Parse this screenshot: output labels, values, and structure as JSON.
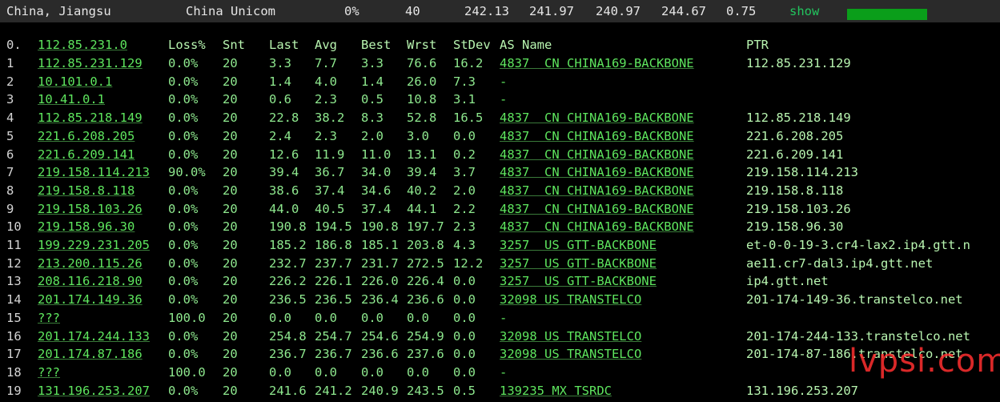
{
  "summary": {
    "location": "China, Jiangsu",
    "isp": "China Unicom",
    "loss": "0%",
    "sent": "40",
    "last": "242.13",
    "avg": "241.97",
    "best": "240.97",
    "worst": "244.67",
    "stdev": "0.75",
    "show_label": "show",
    "bar_color": "#0a9e1a"
  },
  "header": {
    "idx": "0.",
    "host": "112.85.231.0",
    "loss": "Loss%",
    "snt": "Snt",
    "last": "Last",
    "avg": "Avg",
    "best": "Best",
    "wrst": "Wrst",
    "stdev": "StDev",
    "as_name": "AS Name",
    "ptr": "PTR"
  },
  "rows": [
    {
      "idx": "1",
      "host": "112.85.231.129",
      "loss": "0.0%",
      "snt": "20",
      "last": "3.3",
      "avg": "7.7",
      "best": "3.3",
      "wrst": "76.6",
      "stdev": "16.2",
      "as": "4837  CN CHINA169-BACKBONE",
      "ptr": "112.85.231.129"
    },
    {
      "idx": "2",
      "host": "10.101.0.1",
      "loss": "0.0%",
      "snt": "20",
      "last": "1.4",
      "avg": "4.0",
      "best": "1.4",
      "wrst": "26.0",
      "stdev": "7.3",
      "as": "-",
      "ptr": ""
    },
    {
      "idx": "3",
      "host": "10.41.0.1",
      "loss": "0.0%",
      "snt": "20",
      "last": "0.6",
      "avg": "2.3",
      "best": "0.5",
      "wrst": "10.8",
      "stdev": "3.1",
      "as": "-",
      "ptr": ""
    },
    {
      "idx": "4",
      "host": "112.85.218.149",
      "loss": "0.0%",
      "snt": "20",
      "last": "22.8",
      "avg": "38.2",
      "best": "8.3",
      "wrst": "52.8",
      "stdev": "16.5",
      "as": "4837  CN CHINA169-BACKBONE",
      "ptr": "112.85.218.149"
    },
    {
      "idx": "5",
      "host": "221.6.208.205",
      "loss": "0.0%",
      "snt": "20",
      "last": "2.4",
      "avg": "2.3",
      "best": "2.0",
      "wrst": "3.0",
      "stdev": "0.0",
      "as": "4837  CN CHINA169-BACKBONE",
      "ptr": "221.6.208.205"
    },
    {
      "idx": "6",
      "host": "221.6.209.141",
      "loss": "0.0%",
      "snt": "20",
      "last": "12.6",
      "avg": "11.9",
      "best": "11.0",
      "wrst": "13.1",
      "stdev": "0.2",
      "as": "4837  CN CHINA169-BACKBONE",
      "ptr": "221.6.209.141"
    },
    {
      "idx": "7",
      "host": "219.158.114.213",
      "loss": "90.0%",
      "snt": "20",
      "last": "39.4",
      "avg": "36.7",
      "best": "34.0",
      "wrst": "39.4",
      "stdev": "3.7",
      "as": "4837  CN CHINA169-BACKBONE",
      "ptr": "219.158.114.213"
    },
    {
      "idx": "8",
      "host": "219.158.8.118",
      "loss": "0.0%",
      "snt": "20",
      "last": "38.6",
      "avg": "37.4",
      "best": "34.6",
      "wrst": "40.2",
      "stdev": "2.0",
      "as": "4837  CN CHINA169-BACKBONE",
      "ptr": "219.158.8.118"
    },
    {
      "idx": "9",
      "host": "219.158.103.26",
      "loss": "0.0%",
      "snt": "20",
      "last": "44.0",
      "avg": "40.5",
      "best": "37.4",
      "wrst": "44.1",
      "stdev": "2.2",
      "as": "4837  CN CHINA169-BACKBONE",
      "ptr": "219.158.103.26"
    },
    {
      "idx": "10",
      "host": "219.158.96.30",
      "loss": "0.0%",
      "snt": "20",
      "last": "190.8",
      "avg": "194.5",
      "best": "190.8",
      "wrst": "197.7",
      "stdev": "2.3",
      "as": "4837  CN CHINA169-BACKBONE",
      "ptr": "219.158.96.30"
    },
    {
      "idx": "11",
      "host": "199.229.231.205",
      "loss": "0.0%",
      "snt": "20",
      "last": "185.2",
      "avg": "186.8",
      "best": "185.1",
      "wrst": "203.8",
      "stdev": "4.3",
      "as": "3257  US GTT-BACKBONE",
      "ptr": "et-0-0-19-3.cr4-lax2.ip4.gtt.n"
    },
    {
      "idx": "12",
      "host": "213.200.115.26",
      "loss": "0.0%",
      "snt": "20",
      "last": "232.7",
      "avg": "237.7",
      "best": "231.7",
      "wrst": "272.5",
      "stdev": "12.2",
      "as": "3257  US GTT-BACKBONE",
      "ptr": "ae11.cr7-dal3.ip4.gtt.net"
    },
    {
      "idx": "13",
      "host": "208.116.218.90",
      "loss": "0.0%",
      "snt": "20",
      "last": "226.2",
      "avg": "226.1",
      "best": "226.0",
      "wrst": "226.4",
      "stdev": "0.0",
      "as": "3257  US GTT-BACKBONE",
      "ptr": "ip4.gtt.net"
    },
    {
      "idx": "14",
      "host": "201.174.149.36",
      "loss": "0.0%",
      "snt": "20",
      "last": "236.5",
      "avg": "236.5",
      "best": "236.4",
      "wrst": "236.6",
      "stdev": "0.0",
      "as": "32098 US TRANSTELCO",
      "ptr": "201-174-149-36.transtelco.net"
    },
    {
      "idx": "15",
      "host": "???",
      "loss": "100.0",
      "snt": "20",
      "last": "0.0",
      "avg": "0.0",
      "best": "0.0",
      "wrst": "0.0",
      "stdev": "0.0",
      "as": "-",
      "ptr": ""
    },
    {
      "idx": "16",
      "host": "201.174.244.133",
      "loss": "0.0%",
      "snt": "20",
      "last": "254.8",
      "avg": "254.7",
      "best": "254.6",
      "wrst": "254.9",
      "stdev": "0.0",
      "as": "32098 US TRANSTELCO",
      "ptr": "201-174-244-133.transtelco.net"
    },
    {
      "idx": "17",
      "host": "201.174.87.186",
      "loss": "0.0%",
      "snt": "20",
      "last": "236.7",
      "avg": "236.7",
      "best": "236.6",
      "wrst": "237.6",
      "stdev": "0.0",
      "as": "32098 US TRANSTELCO",
      "ptr": "201-174-87-186.transtelco.net"
    },
    {
      "idx": "18",
      "host": "???",
      "loss": "100.0",
      "snt": "20",
      "last": "0.0",
      "avg": "0.0",
      "best": "0.0",
      "wrst": "0.0",
      "stdev": "0.0",
      "as": "-",
      "ptr": ""
    },
    {
      "idx": "19",
      "host": "131.196.253.207",
      "loss": "0.0%",
      "snt": "20",
      "last": "241.6",
      "avg": "241.2",
      "best": "240.9",
      "wrst": "243.5",
      "stdev": "0.5",
      "as": "139235 MX TSRDC",
      "ptr": "131.196.253.207"
    }
  ],
  "watermark": "lvpsi.com"
}
